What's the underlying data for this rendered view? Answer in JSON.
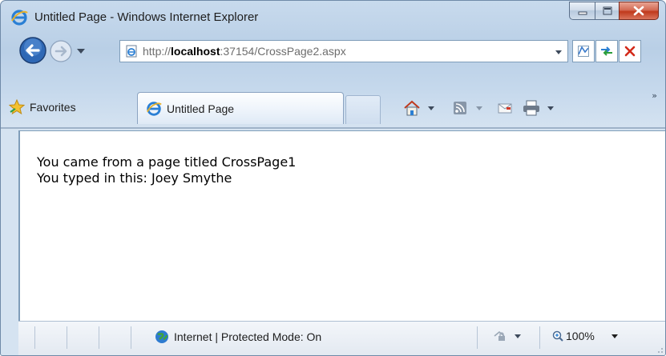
{
  "window": {
    "title": "Untitled Page - Windows Internet Explorer"
  },
  "address": {
    "url_prefix": "http://",
    "url_host": "localhost",
    "url_rest": ":37154/CrossPage2.aspx"
  },
  "favorites": {
    "label": "Favorites"
  },
  "tabs": [
    {
      "label": "Untitled Page"
    }
  ],
  "content": {
    "line1": "You came from a page titled CrossPage1",
    "line2": "You typed in this: Joey Smythe"
  },
  "status": {
    "zone": "Internet | Protected Mode: On",
    "zoom": "100%"
  },
  "colors": {
    "close_button": "#c0391c",
    "frame": "#c8daed",
    "ie_blue": "#2a7fd4"
  }
}
